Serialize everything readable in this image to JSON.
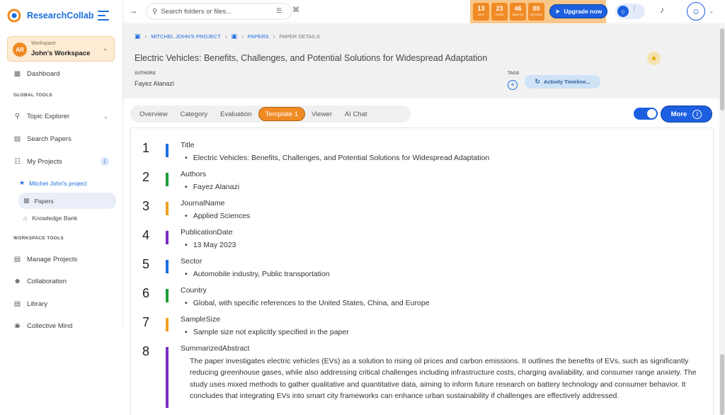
{
  "brand": {
    "name": "ResearchCollab"
  },
  "workspace": {
    "initials": "AR",
    "label": "Workspace",
    "name": "John's Workspace"
  },
  "sidebar": {
    "dashboard": "Dashboard",
    "global_tools_label": "GLOBAL TOOLS",
    "topic_explorer": "Topic Explorer",
    "search_papers": "Search Papers",
    "my_projects": "My Projects",
    "my_projects_count": "1",
    "project_name": "Mitchel John's project",
    "papers": "Papers",
    "knowledge_bank": "Knowledge Bank",
    "workspace_tools_label": "WORKSPACE TOOLS",
    "manage_projects": "Manage Projects",
    "collaboration": "Collaboration",
    "library": "Library",
    "collective_mind": "Collective Mind"
  },
  "topbar": {
    "search_placeholder": "Search folders or files...",
    "countdown": [
      {
        "value": "13",
        "unit": "DAYS"
      },
      {
        "value": "23",
        "unit": "HOURS"
      },
      {
        "value": "46",
        "unit": "MINUTES"
      },
      {
        "value": "00",
        "unit": "SECONDS"
      }
    ],
    "upgrade_label": "Upgrade now"
  },
  "breadcrumb": {
    "project": "MITCHEL JOHN'S PROJECT",
    "papers": "PAPERS",
    "current": "PAPER DETAILS"
  },
  "paper": {
    "title": "Electric Vehicles: Benefits, Challenges, and Potential Solutions for Widespread Adaptation",
    "authors_label": "AUTHORS",
    "authors": "Fayez Alanazi",
    "tags_label": "TAGS",
    "timeline_label": "Activity Timeline..."
  },
  "tabs": [
    "Overview",
    "Category",
    "Evaluation",
    "Template 1",
    "Viewer",
    "AI Chat"
  ],
  "active_tab": "Template 1",
  "more_label": "More",
  "fields": [
    {
      "num": "1",
      "label": "Title",
      "value": "Electric Vehicles: Benefits, Challenges, and Potential Solutions for Widespread Adaptation",
      "color": "#1c6fe0"
    },
    {
      "num": "2",
      "label": "Authors",
      "value": "Fayez Alanazi",
      "color": "#1f9d3a"
    },
    {
      "num": "3",
      "label": "JournalName",
      "value": "Applied Sciences",
      "color": "#f0a020"
    },
    {
      "num": "4",
      "label": "PublicationDate",
      "value": "13 May 2023",
      "color": "#7a2bc4"
    },
    {
      "num": "5",
      "label": "Sector",
      "value": "Automobile industry, Public transportation",
      "color": "#1c6fe0"
    },
    {
      "num": "6",
      "label": "Country",
      "value": "Global, with specific references to the United States, China, and Europe",
      "color": "#1f9d3a"
    },
    {
      "num": "7",
      "label": "SampleSize",
      "value": "Sample size not explicitly specified in the paper",
      "color": "#f0a020"
    },
    {
      "num": "8",
      "label": "SummarizedAbstract",
      "value": "The paper investigates electric vehicles (EVs) as a solution to rising oil prices and carbon emissions. It outlines the benefits of EVs, such as significantly reducing greenhouse gases, while also addressing critical challenges including infrastructure costs, charging availability, and consumer range anxiety. The study uses mixed methods to gather qualitative and quantitative data, aiming to inform future research on battery technology and consumer behavior. It concludes that integrating EVs into smart city frameworks can enhance urban sustainability if challenges are effectively addressed.",
      "color": "#7a2bc4"
    }
  ]
}
